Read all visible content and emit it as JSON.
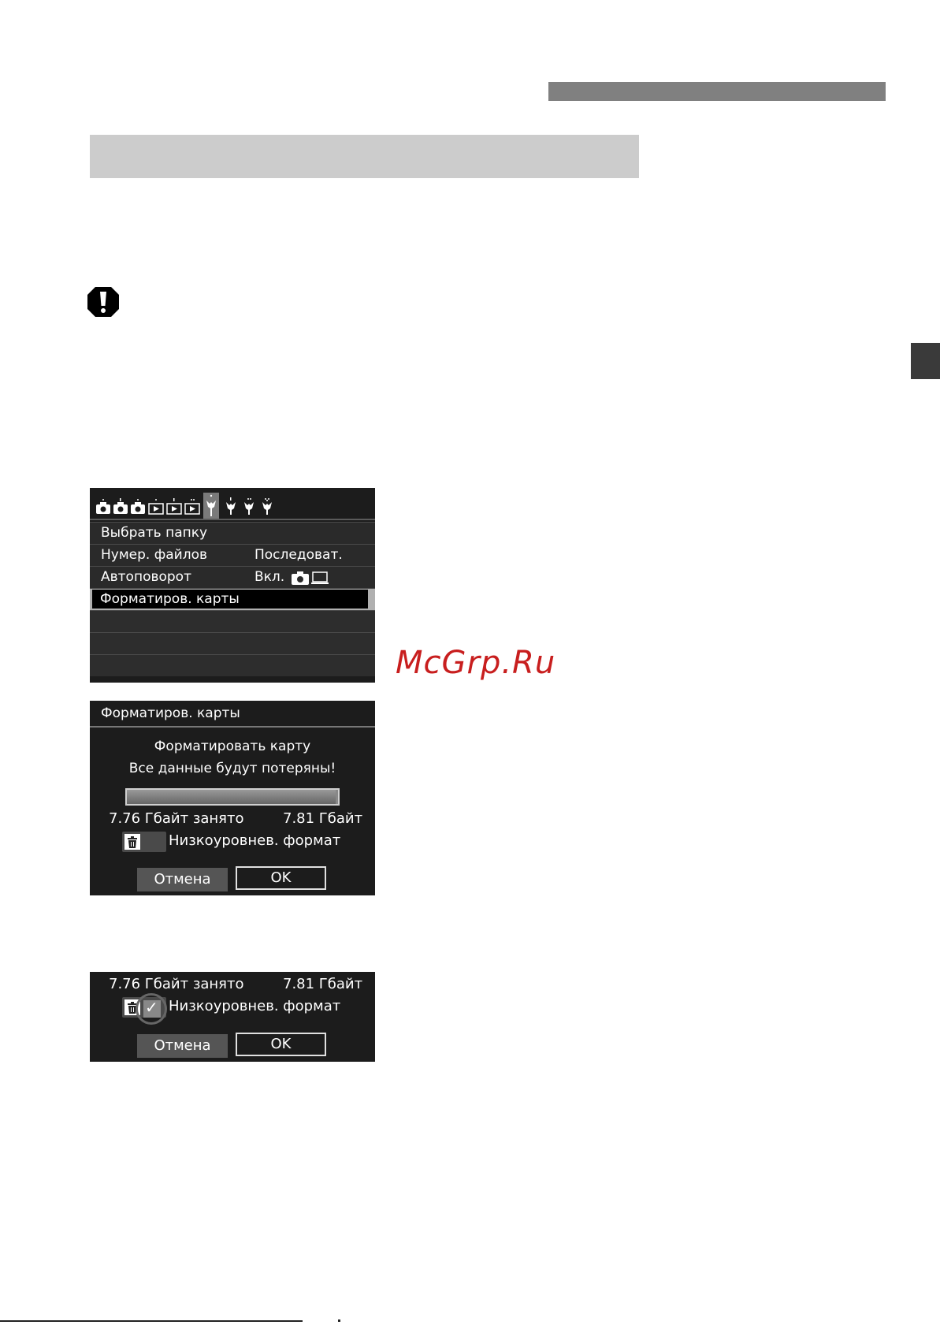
{
  "menu": {
    "items": [
      {
        "label": "Выбрать папку",
        "value": ""
      },
      {
        "label": "Нумер. файлов",
        "value": "Последоват."
      },
      {
        "label": "Автоповорот",
        "value": "Вкл."
      },
      {
        "label": "Форматиров. карты",
        "value": ""
      }
    ],
    "selected_index": 3,
    "tab_icons": [
      "camera-tab-icon-1",
      "camera-tab-icon-2",
      "camera-tab-icon-3",
      "play-tab-icon-1",
      "play-tab-icon-2",
      "play-tab-icon-3",
      "setup-tab-icon-1",
      "setup-tab-icon-2",
      "setup-tab-icon-3",
      "setup-tab-icon-4"
    ],
    "active_tab": 6
  },
  "format_dialog": {
    "title": "Форматиров. карты",
    "message1": "Форматировать карту",
    "message2": "Все данные будут потеряны!",
    "used": "7.76 Гбайт занято",
    "total": "7.81 Гбайт",
    "used_fraction": 0.99,
    "low_level_label": "Низкоуровнев. формат",
    "low_level_checked": false,
    "cancel_label": "Отмена",
    "ok_label": "OK"
  },
  "format_dialog_checked": {
    "used": "7.76 Гбайт занято",
    "total": "7.81 Гбайт",
    "low_level_label": "Низкоуровнев. формат",
    "low_level_checked": true,
    "checkmark": "✓",
    "cancel_label": "Отмена",
    "ok_label": "OK"
  },
  "watermark": "McGrp.Ru",
  "colors": {
    "screen_bg": "#1c1c1c",
    "header_bar": "#808080",
    "section_band": "#cccccc",
    "watermark": "#c81e1e"
  }
}
